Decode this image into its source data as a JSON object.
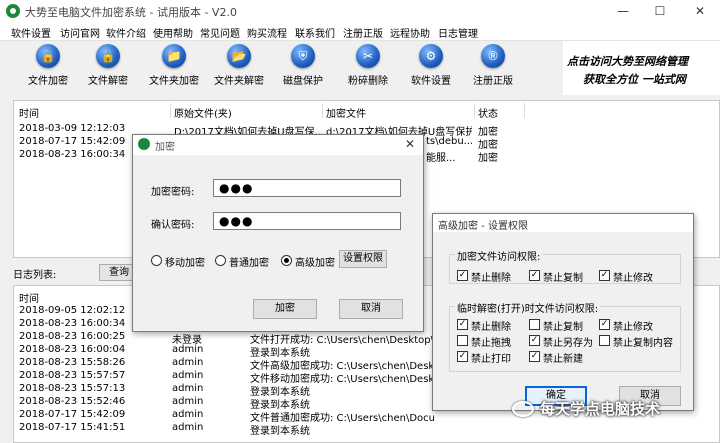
{
  "window": {
    "title": "大势至电脑文件加密系统 - 试用版本 - V2.0",
    "minimize": "—",
    "maximize": "☐",
    "close": "✕"
  },
  "menu": [
    "软件设置",
    "访问官网",
    "软件介绍",
    "使用帮助",
    "常见问题",
    "购买流程",
    "联系我们",
    "注册正版",
    "远程协助",
    "日志管理"
  ],
  "toolbar": [
    {
      "label": "文件加密",
      "icon": "document-lock-icon"
    },
    {
      "label": "文件解密",
      "icon": "document-unlock-icon"
    },
    {
      "label": "文件夹加密",
      "icon": "folder-lock-icon"
    },
    {
      "label": "文件夹解密",
      "icon": "folder-unlock-icon"
    },
    {
      "label": "磁盘保护",
      "icon": "disk-shield-icon"
    },
    {
      "label": "粉碎删除",
      "icon": "shredder-icon"
    },
    {
      "label": "软件设置",
      "icon": "gear-icon"
    },
    {
      "label": "注册正版",
      "icon": "registered-icon"
    }
  ],
  "banner": {
    "line1": "点击访问大势至网络管理",
    "line2": "获取全方位 一站式网"
  },
  "file_table": {
    "headers": [
      "时间",
      "原始文件(夹)",
      "加密文件",
      "状态"
    ],
    "rows": [
      [
        "2018-03-09 12:12:03",
        "D:\\2017文档\\如何去掉U盘写保...",
        "d:\\2017文档\\如何去掉U盘写保护...",
        "加密"
      ],
      [
        "2018-07-17 15:42:09",
        "",
        "ts\\debu...",
        "加密"
      ],
      [
        "2018-08-23 16:00:34",
        "",
        "能服...",
        "加密"
      ]
    ]
  },
  "log": {
    "label": "日志列表:",
    "query_button": "查询",
    "headers": [
      "时间"
    ],
    "rows": [
      [
        "2018-09-05 12:02:12",
        "",
        ""
      ],
      [
        "2018-08-23 16:00:34",
        "",
        ""
      ],
      [
        "2018-08-23 16:00:25",
        "未登录",
        "文件打开成功: C:\\Users\\chen\\Desktop\\健能"
      ],
      [
        "2018-08-23 16:00:04",
        "admin",
        "登录到本系统"
      ],
      [
        "2018-08-23 15:58:26",
        "admin",
        "文件高级加密成功: C:\\Users\\chen\\Desktop\\"
      ],
      [
        "2018-08-23 15:57:57",
        "admin",
        "文件移动加密成功: C:\\Users\\chen\\Desktop\\"
      ],
      [
        "2018-08-23 15:57:13",
        "admin",
        "登录到本系统"
      ],
      [
        "2018-08-23 15:52:46",
        "admin",
        "登录到本系统"
      ],
      [
        "2018-07-17 15:42:09",
        "admin",
        "文件普通加密成功: C:\\Users\\chen\\Docume"
      ],
      [
        "2018-07-17 15:41:51",
        "admin",
        "登录到本系统"
      ]
    ]
  },
  "encrypt_dialog": {
    "title": "加密",
    "close": "✕",
    "password_label": "加密密码:",
    "password_value": "●●●",
    "confirm_label": "确认密码:",
    "confirm_value": "●●●",
    "modes": [
      {
        "label": "移动加密",
        "checked": false
      },
      {
        "label": "普通加密",
        "checked": false
      },
      {
        "label": "高级加密",
        "checked": true
      }
    ],
    "permissions_button": "设置权限",
    "ok_button": "加密",
    "cancel_button": "取消"
  },
  "perm_dialog": {
    "title": "高级加密 - 设置权限",
    "group1": {
      "title": "加密文件访问权限:",
      "items": [
        {
          "label": "禁止删除",
          "checked": true
        },
        {
          "label": "禁止复制",
          "checked": true
        },
        {
          "label": "禁止修改",
          "checked": true
        }
      ]
    },
    "group2": {
      "title": "临时解密(打开)时文件访问权限:",
      "items": [
        {
          "label": "禁止删除",
          "checked": true
        },
        {
          "label": "禁止复制",
          "checked": false
        },
        {
          "label": "禁止修改",
          "checked": true
        },
        {
          "label": "禁止拖拽",
          "checked": false
        },
        {
          "label": "禁止另存为",
          "checked": true
        },
        {
          "label": "禁止复制内容",
          "checked": false
        },
        {
          "label": "禁止打印",
          "checked": true
        },
        {
          "label": "禁止新建",
          "checked": true
        }
      ]
    },
    "ok_button": "确定",
    "cancel_button": "取消"
  },
  "watermark": {
    "text": "每天学点电脑技术"
  }
}
